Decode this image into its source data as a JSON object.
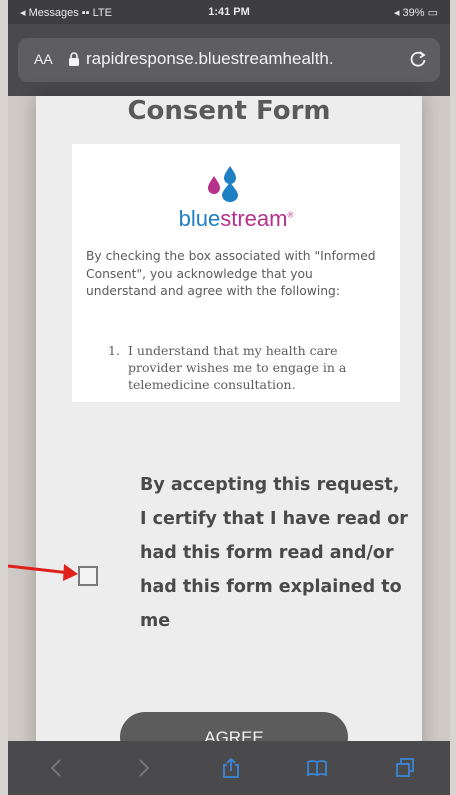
{
  "status_bar": {
    "left": "◂ Messages ▪▪ LTE",
    "time": "1:41 PM",
    "right": "◂ 39% ▭"
  },
  "url_bar": {
    "text_size": "AA",
    "url": "rapidresponse.bluestreamhealth."
  },
  "page": {
    "title": "Consent Form",
    "logo_prefix": "blue",
    "logo_suffix": "stream",
    "intro": "By checking the box associated with \"Informed Consent\", you acknowledge that you understand and agree with the following:",
    "list_number": "1.",
    "list_item": "I understand that my health care provider wishes me to engage in a telemedicine consultation.",
    "consent_text": "By accepting this request, I certify that I have read or had this form read and/or had this form explained to me",
    "agree_label": "AGREE"
  },
  "colors": {
    "brand_blue": "#1e7fc3",
    "brand_magenta": "#b5318a",
    "arrow_red": "#e0201b"
  }
}
